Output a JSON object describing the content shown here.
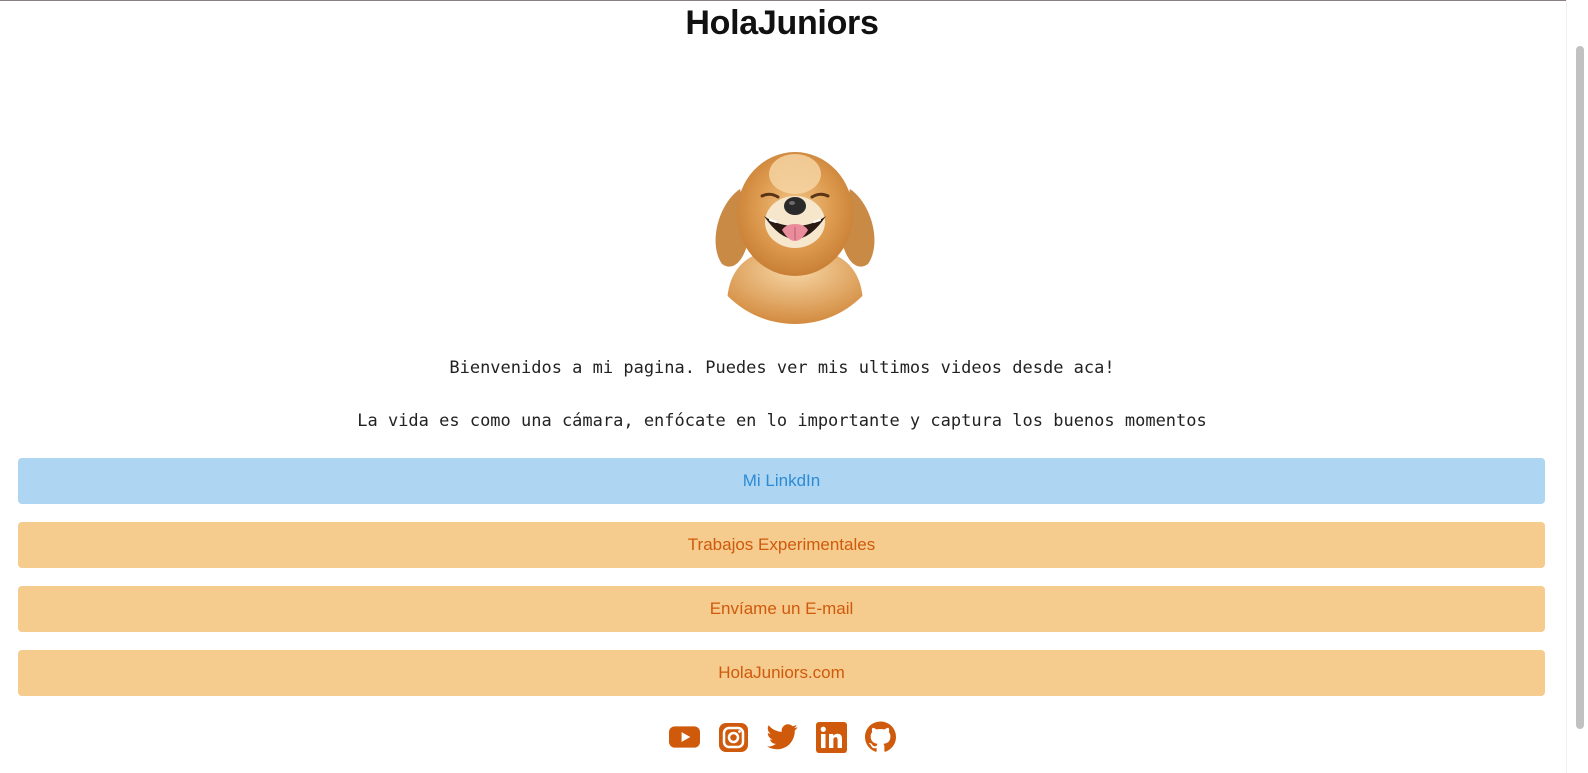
{
  "header": {
    "title": "HolaJuniors"
  },
  "profile": {
    "avatar_icon": "golden-retriever-photo",
    "bio_line_1": "Bienvenidos a mi pagina. Puedes ver mis ultimos videos desde aca!",
    "bio_line_2": "La vida es como una cámara, enfócate en lo importante y captura los buenos momentos"
  },
  "links": [
    {
      "label": "Mi LinkdIn",
      "style": "blue"
    },
    {
      "label": "Trabajos Experimentales",
      "style": "orange"
    },
    {
      "label": "Envíame un E-mail",
      "style": "orange"
    },
    {
      "label": "HolaJuniors.com",
      "style": "orange"
    }
  ],
  "social": [
    {
      "icon": "youtube-icon"
    },
    {
      "icon": "instagram-icon"
    },
    {
      "icon": "twitter-icon"
    },
    {
      "icon": "linkedin-icon"
    },
    {
      "icon": "github-icon"
    }
  ],
  "colors": {
    "accent_orange": "#cf5a0c",
    "button_orange": "#f5cb8e",
    "button_blue": "#aed5f1",
    "text_blue": "#2b8bd6"
  }
}
